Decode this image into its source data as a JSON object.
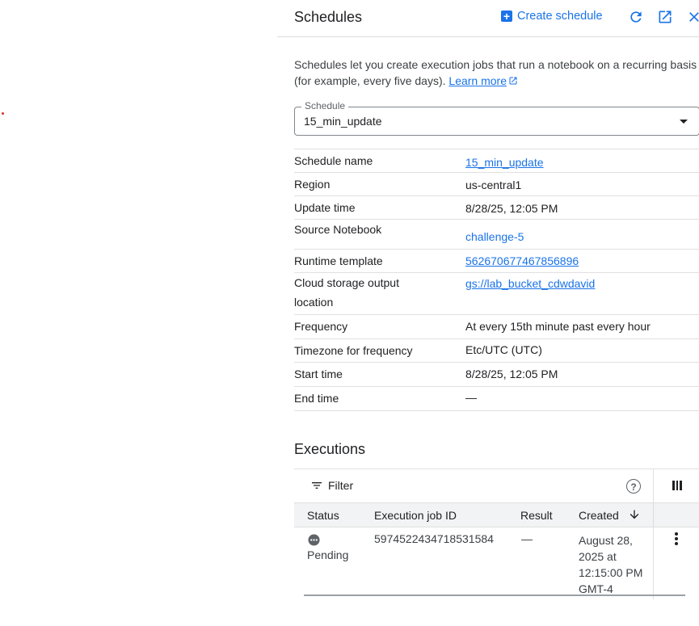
{
  "header": {
    "title": "Schedules",
    "create_label": "Create schedule",
    "icons": [
      "refresh-icon",
      "open-in-new-icon",
      "close-icon"
    ]
  },
  "description": {
    "text": "Schedules let you create execution jobs that run a notebook on a recurring basis (for example, every five days).",
    "learn_more": "Learn more"
  },
  "schedule_select": {
    "label": "Schedule",
    "value": "15_min_update"
  },
  "details": {
    "schedule_name": {
      "label": "Schedule name",
      "value": "15_min_update"
    },
    "region": {
      "label": "Region",
      "value": "us-central1"
    },
    "update_time": {
      "label": "Update time",
      "value": "8/28/25, 12:05 PM"
    },
    "source_notebook": {
      "label": "Source Notebook",
      "value": "challenge-5"
    },
    "runtime_template": {
      "label": "Runtime template",
      "value": "562670677467856896"
    },
    "cloud_storage": {
      "label_line1": "Cloud storage output",
      "label_line2": "location",
      "value": "gs://lab_bucket_cdwdavid"
    },
    "frequency": {
      "label": "Frequency",
      "value": "At every 15th minute past every hour"
    },
    "timezone": {
      "label": "Timezone for frequency",
      "value": "Etc/UTC (UTC)"
    },
    "start_time": {
      "label": "Start time",
      "value": "8/28/25, 12:05 PM"
    },
    "end_time": {
      "label": "End time",
      "value": "—"
    }
  },
  "executions": {
    "title": "Executions",
    "filter_label": "Filter",
    "columns": {
      "status": "Status",
      "job_id": "Execution job ID",
      "result": "Result",
      "created": "Created"
    },
    "rows": [
      {
        "status": "Pending",
        "job_id": "5974522434718531584",
        "result": "—",
        "created_line1": "August 28,",
        "created_line2": "2025 at",
        "created_line3": "12:15:00 PM",
        "created_line4": "GMT-4"
      }
    ]
  },
  "colors": {
    "accent": "#1a73e8",
    "text": "#202124",
    "divider": "#e0e0e0"
  }
}
